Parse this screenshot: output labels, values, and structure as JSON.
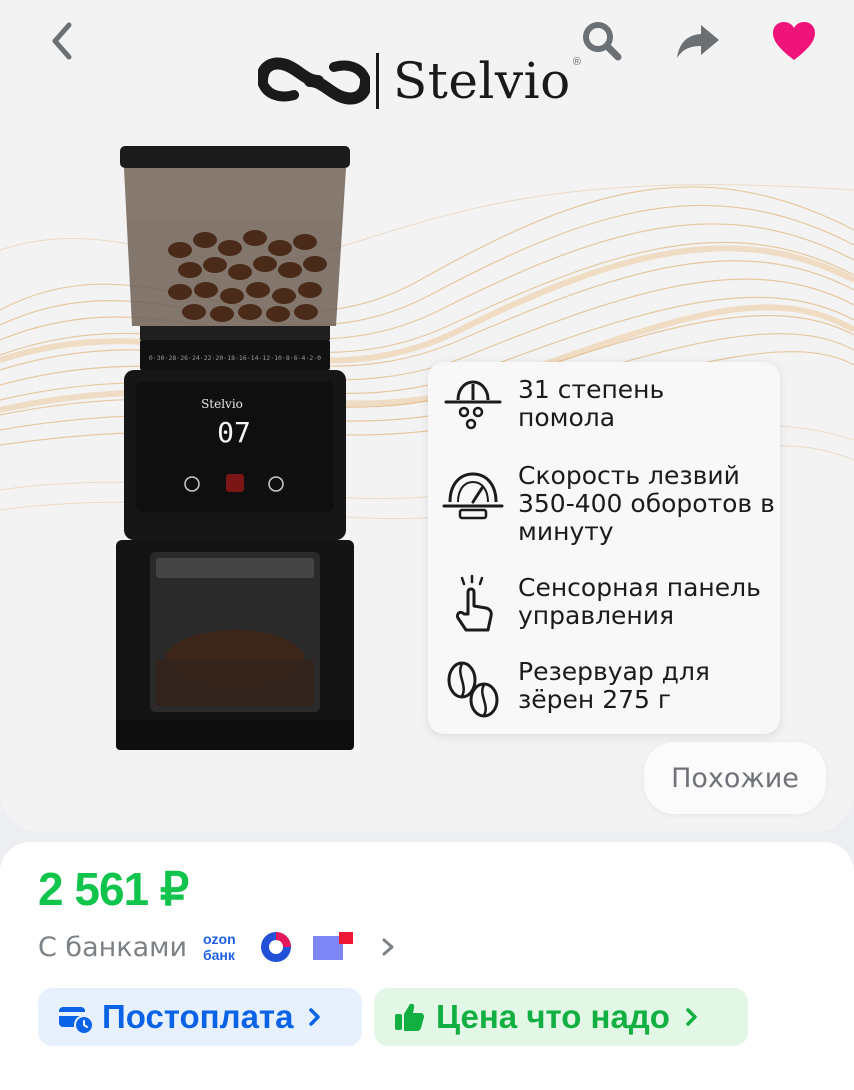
{
  "header": {
    "back_icon": "chevron-left-icon",
    "search_icon": "search-icon",
    "share_icon": "share-arrow-icon",
    "favorite_icon": "heart-icon",
    "favorite_color": "#f0147a"
  },
  "banner": {
    "brand_name": "Stelvio",
    "brand_reg": "®",
    "display_value": "07",
    "scale_text": "0·30·28·26·24·22·20·18·16·14·12·10·8·6·4·2·0",
    "features": [
      {
        "icon": "grind-icon",
        "text": "31 степень помола"
      },
      {
        "icon": "speedometer-icon",
        "text": "Скорость лезвий 350-400 оборотов в минуту"
      },
      {
        "icon": "touch-icon",
        "text": "Сенсорная панель управления"
      },
      {
        "icon": "coffee-bean-icon",
        "text": "Резервуар для зёрен 275 г"
      }
    ],
    "similar_label": "Похожие"
  },
  "product": {
    "price": "2 561 ₽",
    "price_color": "#10c44c",
    "banks_label": "С банками",
    "ozon_bank_line1": "ozon",
    "ozon_bank_line2": "банк",
    "chips": [
      {
        "label": "Постоплата",
        "icon": "card-clock-icon",
        "color": "#0a63e6"
      },
      {
        "label": "Цена что надо",
        "icon": "thumbs-up-icon",
        "color": "#12b042"
      }
    ]
  }
}
